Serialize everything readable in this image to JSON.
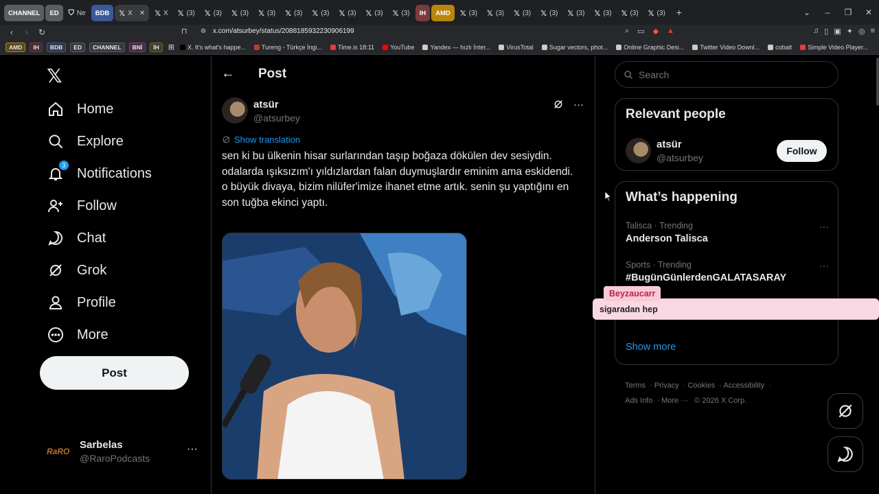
{
  "browser": {
    "tabs": [
      {
        "label": "CHANNEL",
        "kind": "group",
        "color": "#5a5d63"
      },
      {
        "label": "ED",
        "kind": "group",
        "color": "#5a5d63"
      },
      {
        "label": "Ne",
        "kind": "tab"
      },
      {
        "label": "BDB",
        "kind": "group",
        "color": "#3b5998"
      },
      {
        "label": "X",
        "kind": "active"
      },
      {
        "label": "X",
        "kind": "tab"
      },
      {
        "label": "(3)",
        "kind": "tab"
      },
      {
        "label": "(3)",
        "kind": "tab"
      },
      {
        "label": "(3)",
        "kind": "tab"
      },
      {
        "label": "(3)",
        "kind": "tab"
      },
      {
        "label": "(3)",
        "kind": "tab"
      },
      {
        "label": "(3)",
        "kind": "tab"
      },
      {
        "label": "(3)",
        "kind": "tab"
      },
      {
        "label": "(3)",
        "kind": "tab"
      },
      {
        "label": "(3)",
        "kind": "tab"
      },
      {
        "label": "IH",
        "kind": "group",
        "color": "#7a3b3b"
      },
      {
        "label": "AMD",
        "kind": "group",
        "color": "#b8860b"
      },
      {
        "label": "(3)",
        "kind": "tab"
      },
      {
        "label": "(3)",
        "kind": "tab"
      },
      {
        "label": "(3)",
        "kind": "tab"
      },
      {
        "label": "(3)",
        "kind": "tab"
      },
      {
        "label": "(3)",
        "kind": "tab"
      },
      {
        "label": "(3)",
        "kind": "tab"
      },
      {
        "label": "(3)",
        "kind": "tab"
      },
      {
        "label": "(3)",
        "kind": "tab"
      }
    ],
    "url": "x.com/atsurbey/status/2088185932230906199",
    "bookmark_groups": [
      {
        "label": "AMD",
        "color": "#b8860b"
      },
      {
        "label": "IH",
        "color": "#7a3b3b"
      },
      {
        "label": "BDB",
        "color": "#3b5998"
      },
      {
        "label": "ED",
        "color": "#5a5d63"
      },
      {
        "label": "CHANNEL",
        "color": "#5a5d63"
      },
      {
        "label": "BNİ",
        "color": "#8a3b6b"
      },
      {
        "label": "İH",
        "color": "#6b6b2b"
      }
    ],
    "bookmarks": [
      {
        "label": "X. It's what's happe...",
        "color": "#000000"
      },
      {
        "label": "Tureng - Türkçe İngi...",
        "color": "#c0392b"
      },
      {
        "label": "Time.is 18:11",
        "color": "#e63946"
      },
      {
        "label": "YouTube",
        "color": "#ff0000"
      },
      {
        "label": "Yandex — hızlı İnter...",
        "color": "#cccccc"
      },
      {
        "label": "VirusTotal",
        "color": "#cccccc"
      },
      {
        "label": "Sugar vectors, phot...",
        "color": "#cccccc"
      },
      {
        "label": "Online Graphic Desi...",
        "color": "#cccccc"
      },
      {
        "label": "Twitter Video Downl...",
        "color": "#cccccc"
      },
      {
        "label": "cobalt",
        "color": "#cccccc"
      },
      {
        "label": "Simple Video Player...",
        "color": "#e63946"
      }
    ]
  },
  "nav": {
    "items": [
      {
        "label": "Home",
        "icon": "home-icon"
      },
      {
        "label": "Explore",
        "icon": "search-icon"
      },
      {
        "label": "Notifications",
        "icon": "bell-icon",
        "badge": "3"
      },
      {
        "label": "Follow",
        "icon": "follow-icon"
      },
      {
        "label": "Chat",
        "icon": "chat-icon"
      },
      {
        "label": "Grok",
        "icon": "grok-icon"
      },
      {
        "label": "Profile",
        "icon": "profile-icon"
      },
      {
        "label": "More",
        "icon": "more-icon"
      }
    ],
    "post_button": "Post",
    "account": {
      "name": "Sarbelas",
      "handle": "@RaroPodcasts",
      "logo_text": "RaRO"
    }
  },
  "post": {
    "header_title": "Post",
    "author_name": "atsür",
    "author_handle": "@atsurbey",
    "show_translation": "Show translation",
    "text_lines": [
      "sen ki bu ülkenin hisar surlarından taşıp boğaza dökülen dev sesiydin.",
      "odalarda ışıksızım'ı yıldızlardan falan duymuşlardır eminim ama eskidendi.",
      "o büyük divaya, bizim nilüfer'imize ihanet etme artık. senin şu yaptığını en son tuğba ekinci yaptı."
    ]
  },
  "sidebar": {
    "search_placeholder": "Search",
    "relevant_title": "Relevant people",
    "relevant_person": {
      "name": "atsür",
      "handle": "@atsurbey",
      "follow_label": "Follow"
    },
    "happening_title": "What’s happening",
    "trends": [
      {
        "context": "Talisca · Trending",
        "title": "Anderson Talisca"
      },
      {
        "context": "Sports · Trending",
        "title": "#BugünGünlerdenGALATASARAY"
      }
    ],
    "show_more": "Show more",
    "footer": [
      "Terms",
      "Privacy",
      "Cookies",
      "Accessibility",
      "Ads Info",
      "More ···",
      "© 2026 X Corp."
    ]
  },
  "overlay": {
    "username": "Beyzaucarr",
    "message": "sigaradan hep"
  }
}
